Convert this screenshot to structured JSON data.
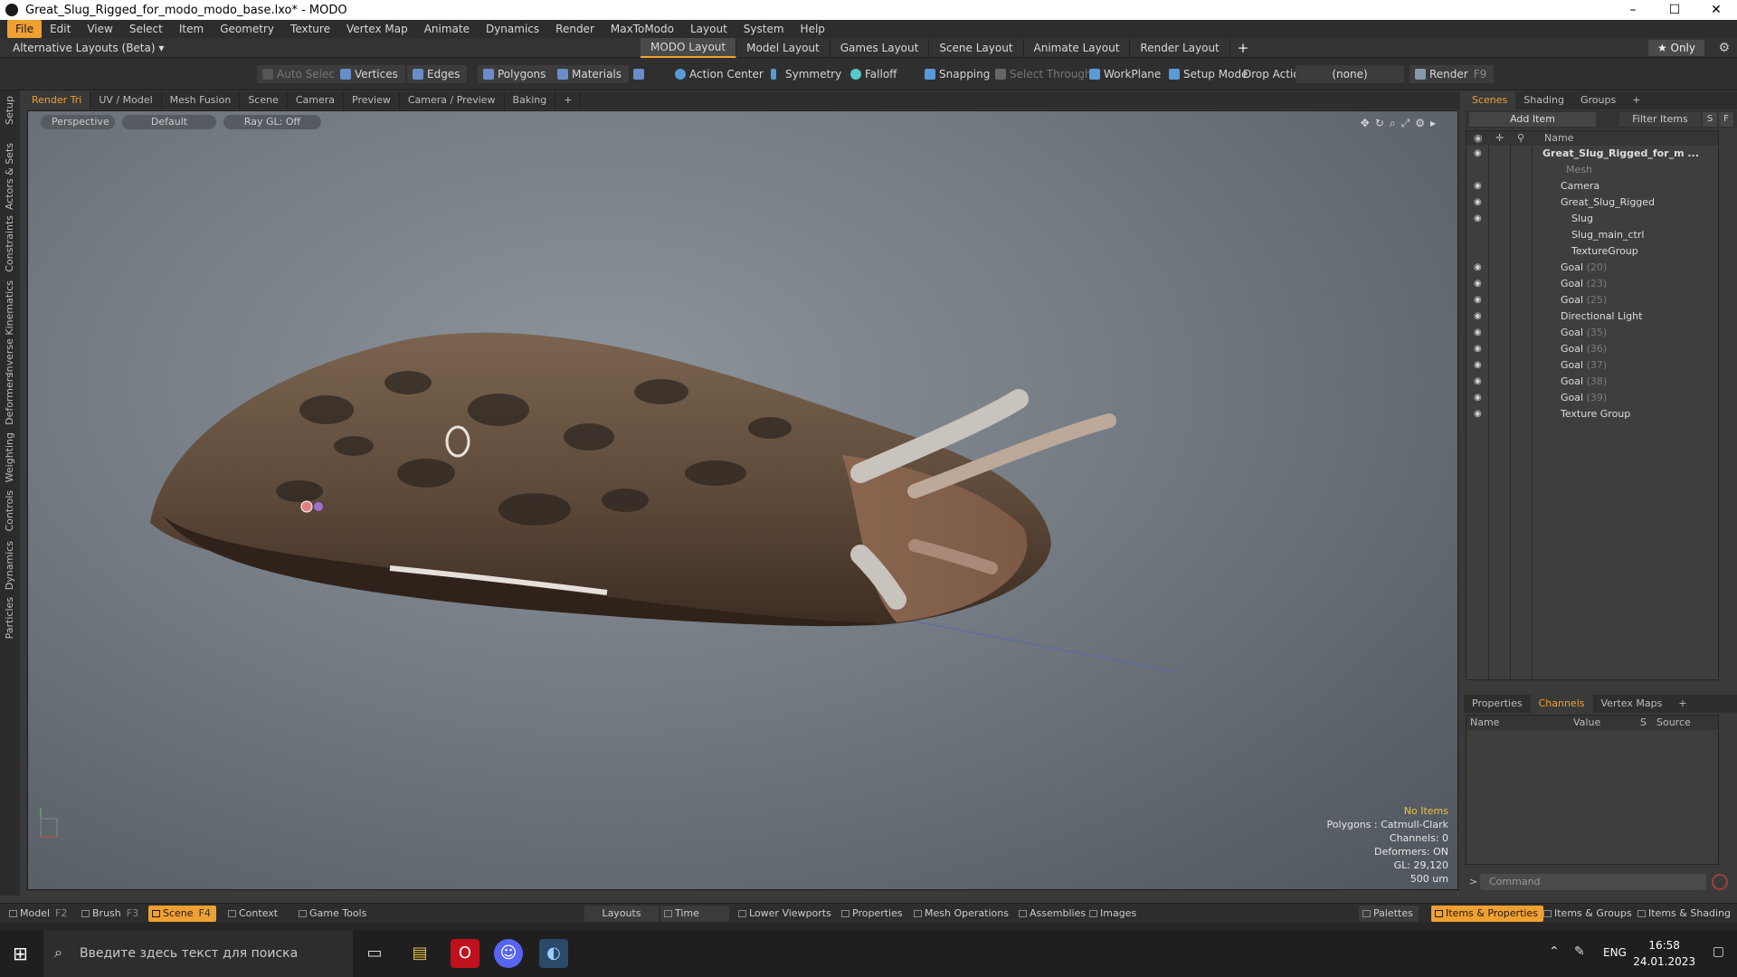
{
  "window": {
    "title": "Great_Slug_Rigged_for_modo_modo_base.lxo* - MODO",
    "controls": [
      "–",
      "☐",
      "✕"
    ]
  },
  "menu": [
    "File",
    "Edit",
    "View",
    "Select",
    "Item",
    "Geometry",
    "Texture",
    "Vertex Map",
    "Animate",
    "Dynamics",
    "Render",
    "MaxToModo",
    "Layout",
    "System",
    "Help"
  ],
  "layout_bar": {
    "alt_layouts": "Alternative Layouts (Beta) ▾",
    "tabs": [
      "MODO Layout",
      "Model Layout",
      "Games Layout",
      "Scene Layout",
      "Animate Layout",
      "Render Layout"
    ],
    "plus": "+",
    "only": "★  Only",
    "gear": "⚙"
  },
  "toolbar": {
    "auto_select": "Auto Select",
    "vertices": "Vertices",
    "edges": "Edges",
    "polygons": "Polygons",
    "materials": "Materials",
    "action_center": "Action Center",
    "symmetry": "Symmetry",
    "falloff": "Falloff",
    "snapping": "Snapping",
    "select_through": "Select Through",
    "workplane": "WorkPlane",
    "setup_mode": "Setup Mode",
    "drop_action": "Drop Action",
    "drop_value": "(none)",
    "render": "Render",
    "render_key": "F9"
  },
  "left_tabs": [
    "Setup",
    "Actors & Sets",
    "Constraints",
    "Inverse Kinematics",
    "Deformers",
    "Weighting",
    "Controls",
    "Dynamics",
    "Particles"
  ],
  "viewport_tabs": [
    "Render Tri",
    "UV / Model",
    "Mesh Fusion",
    "Scene",
    "Camera",
    "Preview",
    "Camera / Preview",
    "Baking",
    "+"
  ],
  "viewport": {
    "view": "Perspective",
    "style": "Default",
    "raygl": "Ray GL: Off",
    "info": {
      "selection": "No Items",
      "polygons": "Polygons : Catmull-Clark",
      "channels": "Channels: 0",
      "deformers": "Deformers: ON",
      "gl": "GL: 29,120",
      "scale": "500 um"
    }
  },
  "right_tabs": [
    "Scenes",
    "Shading",
    "Groups",
    "+"
  ],
  "scene_tree": {
    "add_item": "Add Item",
    "filter": "Filter Items",
    "s": "S",
    "f": "F",
    "name_header": "Name",
    "items": [
      {
        "label": "Great_Slug_Rigged_for_m ...",
        "count": ""
      },
      {
        "label": "Mesh",
        "count": ""
      },
      {
        "label": "Camera",
        "count": ""
      },
      {
        "label": "Great_Slug_Rigged",
        "count": ""
      },
      {
        "label": "Slug",
        "count": ""
      },
      {
        "label": "Slug_main_ctrl",
        "count": ""
      },
      {
        "label": "TextureGroup",
        "count": ""
      },
      {
        "label": "Goal",
        "count": "(20)"
      },
      {
        "label": "Goal",
        "count": "(23)"
      },
      {
        "label": "Goal",
        "count": "(25)"
      },
      {
        "label": "Directional Light",
        "count": ""
      },
      {
        "label": "Goal",
        "count": "(35)"
      },
      {
        "label": "Goal",
        "count": "(36)"
      },
      {
        "label": "Goal",
        "count": "(37)"
      },
      {
        "label": "Goal",
        "count": "(38)"
      },
      {
        "label": "Goal",
        "count": "(39)"
      },
      {
        "label": "Texture Group",
        "count": ""
      }
    ]
  },
  "lower_tabs": [
    "Properties",
    "Channels",
    "Vertex Maps",
    "+"
  ],
  "channels": {
    "name": "Name",
    "value": "Value",
    "s": "S",
    "source": "Source"
  },
  "command": {
    "prompt": ">",
    "placeholder": "Command"
  },
  "bottom": {
    "model": "Model",
    "model_key": "F2",
    "brush": "Brush",
    "brush_key": "F3",
    "scene": "Scene",
    "scene_key": "F4",
    "context": "Context",
    "game_tools": "Game Tools",
    "layouts": "Layouts",
    "time": "Time",
    "lower_viewports": "Lower Viewports",
    "properties": "Properties",
    "mesh_operations": "Mesh Operations",
    "assemblies": "Assemblies",
    "images": "Images",
    "palettes": "Palettes",
    "items_properties": "Items & Properties",
    "items_groups": "Items & Groups",
    "items_shading": "Items & Shading"
  },
  "taskbar": {
    "search_placeholder": "Введите здесь текст для поиска",
    "lang": "ENG",
    "time": "16:58",
    "date": "24.01.2023"
  },
  "colors": {
    "accent": "#f0a030",
    "panel": "#3a3a3a"
  }
}
